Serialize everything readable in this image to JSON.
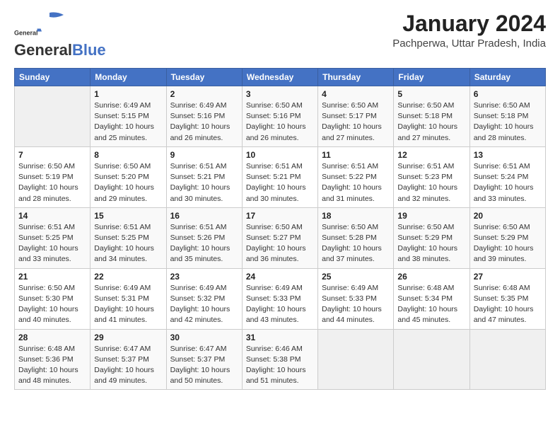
{
  "header": {
    "logo_line1": "General",
    "logo_line2": "Blue",
    "month_title": "January 2024",
    "location": "Pachperwa, Uttar Pradesh, India"
  },
  "weekdays": [
    "Sunday",
    "Monday",
    "Tuesday",
    "Wednesday",
    "Thursday",
    "Friday",
    "Saturday"
  ],
  "weeks": [
    [
      {
        "day": "",
        "info": ""
      },
      {
        "day": "1",
        "info": "Sunrise: 6:49 AM\nSunset: 5:15 PM\nDaylight: 10 hours\nand 25 minutes."
      },
      {
        "day": "2",
        "info": "Sunrise: 6:49 AM\nSunset: 5:16 PM\nDaylight: 10 hours\nand 26 minutes."
      },
      {
        "day": "3",
        "info": "Sunrise: 6:50 AM\nSunset: 5:16 PM\nDaylight: 10 hours\nand 26 minutes."
      },
      {
        "day": "4",
        "info": "Sunrise: 6:50 AM\nSunset: 5:17 PM\nDaylight: 10 hours\nand 27 minutes."
      },
      {
        "day": "5",
        "info": "Sunrise: 6:50 AM\nSunset: 5:18 PM\nDaylight: 10 hours\nand 27 minutes."
      },
      {
        "day": "6",
        "info": "Sunrise: 6:50 AM\nSunset: 5:18 PM\nDaylight: 10 hours\nand 28 minutes."
      }
    ],
    [
      {
        "day": "7",
        "info": "Sunrise: 6:50 AM\nSunset: 5:19 PM\nDaylight: 10 hours\nand 28 minutes."
      },
      {
        "day": "8",
        "info": "Sunrise: 6:50 AM\nSunset: 5:20 PM\nDaylight: 10 hours\nand 29 minutes."
      },
      {
        "day": "9",
        "info": "Sunrise: 6:51 AM\nSunset: 5:21 PM\nDaylight: 10 hours\nand 30 minutes."
      },
      {
        "day": "10",
        "info": "Sunrise: 6:51 AM\nSunset: 5:21 PM\nDaylight: 10 hours\nand 30 minutes."
      },
      {
        "day": "11",
        "info": "Sunrise: 6:51 AM\nSunset: 5:22 PM\nDaylight: 10 hours\nand 31 minutes."
      },
      {
        "day": "12",
        "info": "Sunrise: 6:51 AM\nSunset: 5:23 PM\nDaylight: 10 hours\nand 32 minutes."
      },
      {
        "day": "13",
        "info": "Sunrise: 6:51 AM\nSunset: 5:24 PM\nDaylight: 10 hours\nand 33 minutes."
      }
    ],
    [
      {
        "day": "14",
        "info": "Sunrise: 6:51 AM\nSunset: 5:25 PM\nDaylight: 10 hours\nand 33 minutes."
      },
      {
        "day": "15",
        "info": "Sunrise: 6:51 AM\nSunset: 5:25 PM\nDaylight: 10 hours\nand 34 minutes."
      },
      {
        "day": "16",
        "info": "Sunrise: 6:51 AM\nSunset: 5:26 PM\nDaylight: 10 hours\nand 35 minutes."
      },
      {
        "day": "17",
        "info": "Sunrise: 6:50 AM\nSunset: 5:27 PM\nDaylight: 10 hours\nand 36 minutes."
      },
      {
        "day": "18",
        "info": "Sunrise: 6:50 AM\nSunset: 5:28 PM\nDaylight: 10 hours\nand 37 minutes."
      },
      {
        "day": "19",
        "info": "Sunrise: 6:50 AM\nSunset: 5:29 PM\nDaylight: 10 hours\nand 38 minutes."
      },
      {
        "day": "20",
        "info": "Sunrise: 6:50 AM\nSunset: 5:29 PM\nDaylight: 10 hours\nand 39 minutes."
      }
    ],
    [
      {
        "day": "21",
        "info": "Sunrise: 6:50 AM\nSunset: 5:30 PM\nDaylight: 10 hours\nand 40 minutes."
      },
      {
        "day": "22",
        "info": "Sunrise: 6:49 AM\nSunset: 5:31 PM\nDaylight: 10 hours\nand 41 minutes."
      },
      {
        "day": "23",
        "info": "Sunrise: 6:49 AM\nSunset: 5:32 PM\nDaylight: 10 hours\nand 42 minutes."
      },
      {
        "day": "24",
        "info": "Sunrise: 6:49 AM\nSunset: 5:33 PM\nDaylight: 10 hours\nand 43 minutes."
      },
      {
        "day": "25",
        "info": "Sunrise: 6:49 AM\nSunset: 5:33 PM\nDaylight: 10 hours\nand 44 minutes."
      },
      {
        "day": "26",
        "info": "Sunrise: 6:48 AM\nSunset: 5:34 PM\nDaylight: 10 hours\nand 45 minutes."
      },
      {
        "day": "27",
        "info": "Sunrise: 6:48 AM\nSunset: 5:35 PM\nDaylight: 10 hours\nand 47 minutes."
      }
    ],
    [
      {
        "day": "28",
        "info": "Sunrise: 6:48 AM\nSunset: 5:36 PM\nDaylight: 10 hours\nand 48 minutes."
      },
      {
        "day": "29",
        "info": "Sunrise: 6:47 AM\nSunset: 5:37 PM\nDaylight: 10 hours\nand 49 minutes."
      },
      {
        "day": "30",
        "info": "Sunrise: 6:47 AM\nSunset: 5:37 PM\nDaylight: 10 hours\nand 50 minutes."
      },
      {
        "day": "31",
        "info": "Sunrise: 6:46 AM\nSunset: 5:38 PM\nDaylight: 10 hours\nand 51 minutes."
      },
      {
        "day": "",
        "info": ""
      },
      {
        "day": "",
        "info": ""
      },
      {
        "day": "",
        "info": ""
      }
    ]
  ]
}
